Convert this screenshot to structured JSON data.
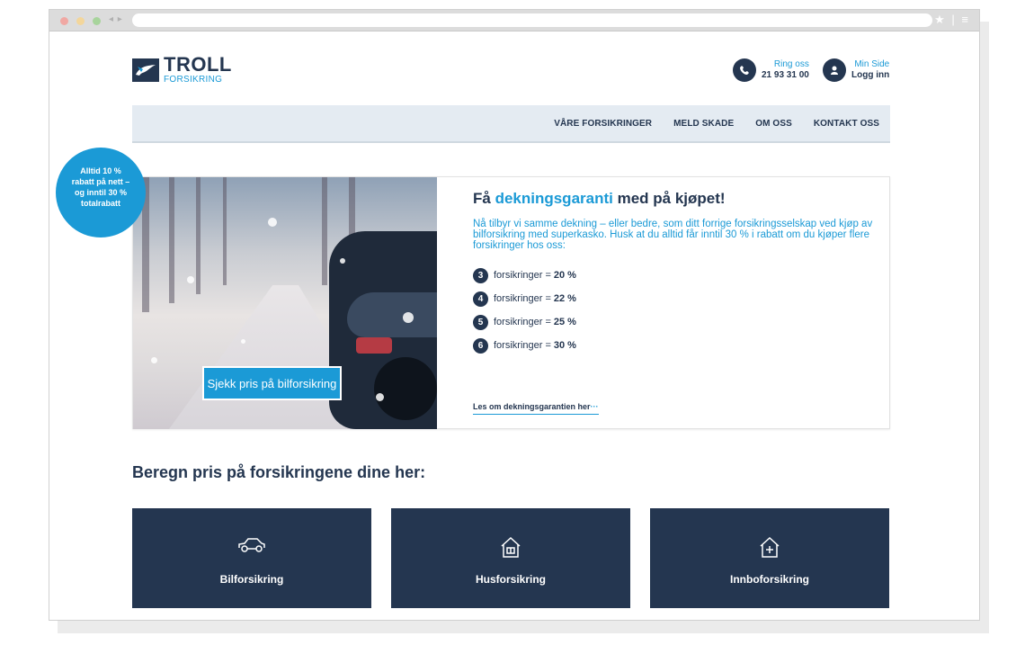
{
  "browser": {
    "nav_arrows": "◂ ▸",
    "right_icons": "★ | ≡"
  },
  "header": {
    "logo_title": "TROLL",
    "logo_sub": "FORSIKRING",
    "call": {
      "small": "Ring oss",
      "strong": "21 93 31 00"
    },
    "login": {
      "small": "Min Side",
      "strong": "Logg inn"
    }
  },
  "nav": {
    "items": [
      "VÅRE FORSIKRINGER",
      "MELD SKADE",
      "OM OSS",
      "KONTAKT OSS"
    ]
  },
  "badge": {
    "line1": "Alltid 10 %",
    "line2": "rabatt på nett –",
    "line3": "og inntil 30 %",
    "line4": "totalrabatt"
  },
  "hero": {
    "cta": "Sjekk pris på bilforsikring",
    "title_pre": "Få ",
    "title_highlight": "dekningsgaranti",
    "title_post": " med på kjøpet!",
    "description": "Nå tilbyr vi samme dekning – eller bedre, som ditt forrige forsikringsselskap ved kjøp av bilforsikring med superkasko. Husk at du alltid får inntil 30 % i rabatt om du kjøper flere forsikringer hos oss:",
    "discounts": [
      {
        "num": "3",
        "text": "forsikringer =",
        "value": "20 %"
      },
      {
        "num": "4",
        "text": "forsikringer =",
        "value": "22 %"
      },
      {
        "num": "5",
        "text": "forsikringer =",
        "value": "25 %"
      },
      {
        "num": "6",
        "text": "forsikringer =",
        "value": "30 %"
      }
    ],
    "read_more": "Les om dekningsgarantien her",
    "read_more_dots": "···"
  },
  "pricing": {
    "title": "Beregn pris på forsikringene dine her:",
    "tiles": [
      {
        "label": "Bilforsikring",
        "icon": "car-icon"
      },
      {
        "label": "Husforsikring",
        "icon": "house-icon"
      },
      {
        "label": "Innboforsikring",
        "icon": "house-plus-icon"
      }
    ]
  },
  "colors": {
    "navy": "#243650",
    "blue": "#1b9ad6",
    "nav_bg": "#e4ebf2"
  }
}
